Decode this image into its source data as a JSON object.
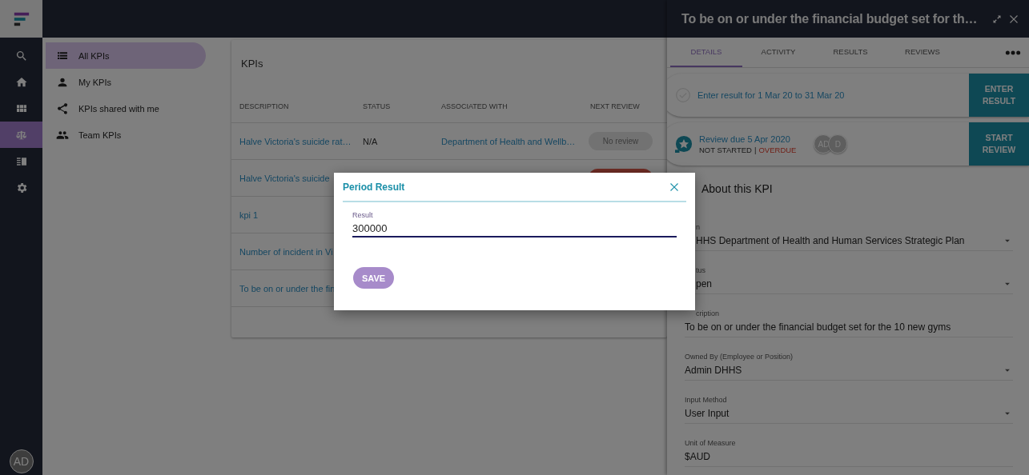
{
  "app_rail": {
    "items": [
      {
        "kind": "search",
        "selected": false
      },
      {
        "kind": "home",
        "selected": false
      },
      {
        "kind": "grid",
        "selected": false
      },
      {
        "kind": "scales",
        "selected": true
      },
      {
        "kind": "library",
        "selected": false
      },
      {
        "kind": "settings",
        "selected": false
      }
    ],
    "avatar": "AD"
  },
  "sidebar": {
    "items": [
      {
        "kind": "list",
        "label": "All KPIs",
        "selected": true
      },
      {
        "kind": "person",
        "label": "My KPIs",
        "selected": false
      },
      {
        "kind": "share",
        "label": "KPIs shared with me",
        "selected": false
      },
      {
        "kind": "people",
        "label": "Team KPIs",
        "selected": false
      }
    ]
  },
  "kpi_list": {
    "title": "KPIs",
    "columns": [
      "DESCRIPTION",
      "STATUS",
      "ASSOCIATED WITH",
      "NEXT REVIEW"
    ],
    "rows": [
      {
        "description": "Halve Victoria's suicide rat…",
        "status": "N/A",
        "associated_with": "Department of Health and Wellb…",
        "next_review": {
          "kind": "none",
          "label": "No review"
        }
      },
      {
        "description": "Halve Victoria's suicide",
        "next_review": {
          "kind": "overdue"
        }
      },
      {
        "description": "kpi 1"
      },
      {
        "description": "Number of incident in Vi"
      },
      {
        "description": "To be on or under the fin"
      }
    ]
  },
  "detail_panel": {
    "title": "To be on or under the financial budget set for th…",
    "tabs": [
      {
        "label": "DETAILS",
        "selected": true
      },
      {
        "label": "ACTIVITY",
        "selected": false
      },
      {
        "label": "RESULTS",
        "selected": false
      },
      {
        "label": "REVIEWS",
        "selected": false
      }
    ],
    "tasks": [
      {
        "kind": "result",
        "text": "Enter result for 1 Mar 20 to 31 Mar 20",
        "done": false,
        "button": "ENTER RESULT"
      },
      {
        "kind": "review",
        "text": "Review due 5 Apr 2020",
        "status": "NOT STARTED",
        "separator": "|",
        "flag": "OVERDUE",
        "avatars": [
          "AD",
          "D"
        ],
        "button": "START REVIEW"
      }
    ],
    "section_title": "About this KPI",
    "fields": [
      {
        "label": "n",
        "value": "HHS Department of Health and Human Services Strategic Plan",
        "dropdown": true
      },
      {
        "label": "tus",
        "value": "pen",
        "dropdown": true
      },
      {
        "label": "cription",
        "value": "To be on or under the financial budget set for the 10 new gyms",
        "dropdown": false
      },
      {
        "label": "Owned By (Employee or Position)",
        "value": "Admin DHHS",
        "dropdown": true
      },
      {
        "label": "Input Method",
        "value": "User Input",
        "dropdown": true
      },
      {
        "label": "Unit of Measure",
        "value": "$AUD",
        "dropdown": false
      }
    ]
  },
  "dialog": {
    "title": "Period Result",
    "field": {
      "label": "Result",
      "value": "300000"
    },
    "button": "SAVE"
  }
}
